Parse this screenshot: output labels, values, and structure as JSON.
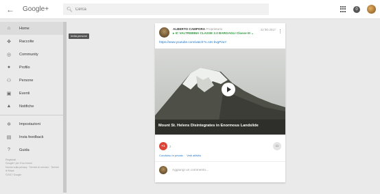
{
  "header": {
    "brand": "Google+",
    "search_placeholder": "Cerca",
    "back_icon": "back-arrow-icon",
    "apps_icon": "apps-grid-icon",
    "notifications_icon": "notifications-icon"
  },
  "sidebar": {
    "items": [
      {
        "label": "Home",
        "icon": "home-icon"
      },
      {
        "label": "Raccolte",
        "icon": "collections-icon"
      },
      {
        "label": "Community",
        "icon": "community-icon"
      },
      {
        "label": "Profilo",
        "icon": "profile-icon"
      },
      {
        "label": "Persone",
        "icon": "people-icon"
      },
      {
        "label": "Eventi",
        "icon": "events-icon"
      },
      {
        "label": "Notifiche",
        "icon": "notifications-icon"
      }
    ],
    "secondary": [
      {
        "label": "Impostazioni",
        "icon": "settings-icon"
      },
      {
        "label": "Invia feedback",
        "icon": "feedback-icon"
      },
      {
        "label": "Guida",
        "icon": "help-icon"
      }
    ],
    "footer": [
      "Registrati",
      "Google+ per il tuo brand",
      "Norme sulla privacy · Termini di servizio · Termini di Maps",
      "©2017 Google"
    ],
    "tooltip": "Invita persone"
  },
  "post": {
    "author": "ALBERTO CAMPORA",
    "role": "Proprietario",
    "community": "▸ IC VALTREBBIA CLASSE 2.0 BARGAGLI Classe III ⌄",
    "date": "22 feb 2017",
    "link": "https://www.youtube.com/watch?v=UK-bvgP2uY",
    "video_title": "Mount St. Helens Disintegrates in Enormous Landslide",
    "plus_label": "+1",
    "plus_count": "2",
    "share_private": "Condiviso in privato",
    "view_activity": "Vedi attività",
    "comment_placeholder": "Aggiungi un commento..."
  },
  "colors": {
    "accent_red": "#db4437",
    "community_green": "#2a9a3a",
    "link_blue": "#1a73c8"
  }
}
